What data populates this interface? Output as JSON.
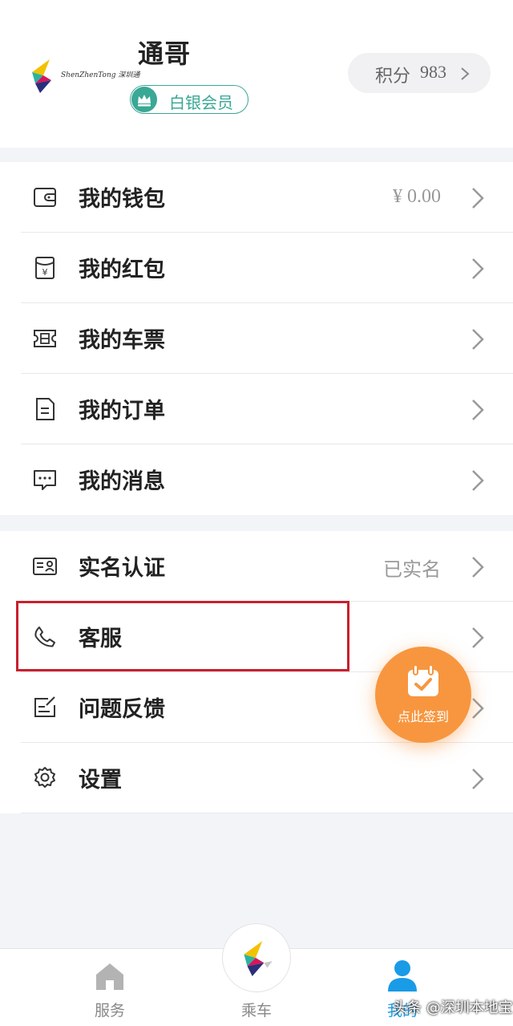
{
  "profile": {
    "logo_text": "ShenZhenTong 深圳通",
    "username": "通哥",
    "member_level": "白银会员",
    "points_label": "积分",
    "points_value": "983"
  },
  "menu_group_1": [
    {
      "label": "我的钱包",
      "value": "¥ 0.00",
      "icon": "wallet-icon"
    },
    {
      "label": "我的红包",
      "value": "",
      "icon": "red-envelope-icon"
    },
    {
      "label": "我的车票",
      "value": "",
      "icon": "ticket-icon"
    },
    {
      "label": "我的订单",
      "value": "",
      "icon": "order-icon"
    },
    {
      "label": "我的消息",
      "value": "",
      "icon": "message-icon"
    }
  ],
  "menu_group_2": [
    {
      "label": "实名认证",
      "value": "已实名",
      "icon": "id-card-icon"
    },
    {
      "label": "客服",
      "value": "",
      "icon": "phone-icon"
    },
    {
      "label": "问题反馈",
      "value": "",
      "icon": "feedback-icon"
    },
    {
      "label": "设置",
      "value": "",
      "icon": "gear-icon"
    }
  ],
  "checkin": {
    "label": "点此签到",
    "icon": "calendar-check-icon"
  },
  "tabbar": {
    "items": [
      {
        "label": "服务",
        "icon": "home-icon",
        "active": false
      },
      {
        "label": "乘车",
        "icon": "app-logo-icon",
        "active": false
      },
      {
        "label": "我的",
        "icon": "user-icon",
        "active": true
      }
    ]
  },
  "watermark": "头条 @深圳本地宝",
  "colors": {
    "accent_green": "#3aa895",
    "checkin_orange": "#f7963f",
    "active_tab_blue": "#1a9be6",
    "highlight_red": "#c8202e",
    "background": "#f3f4f8"
  }
}
